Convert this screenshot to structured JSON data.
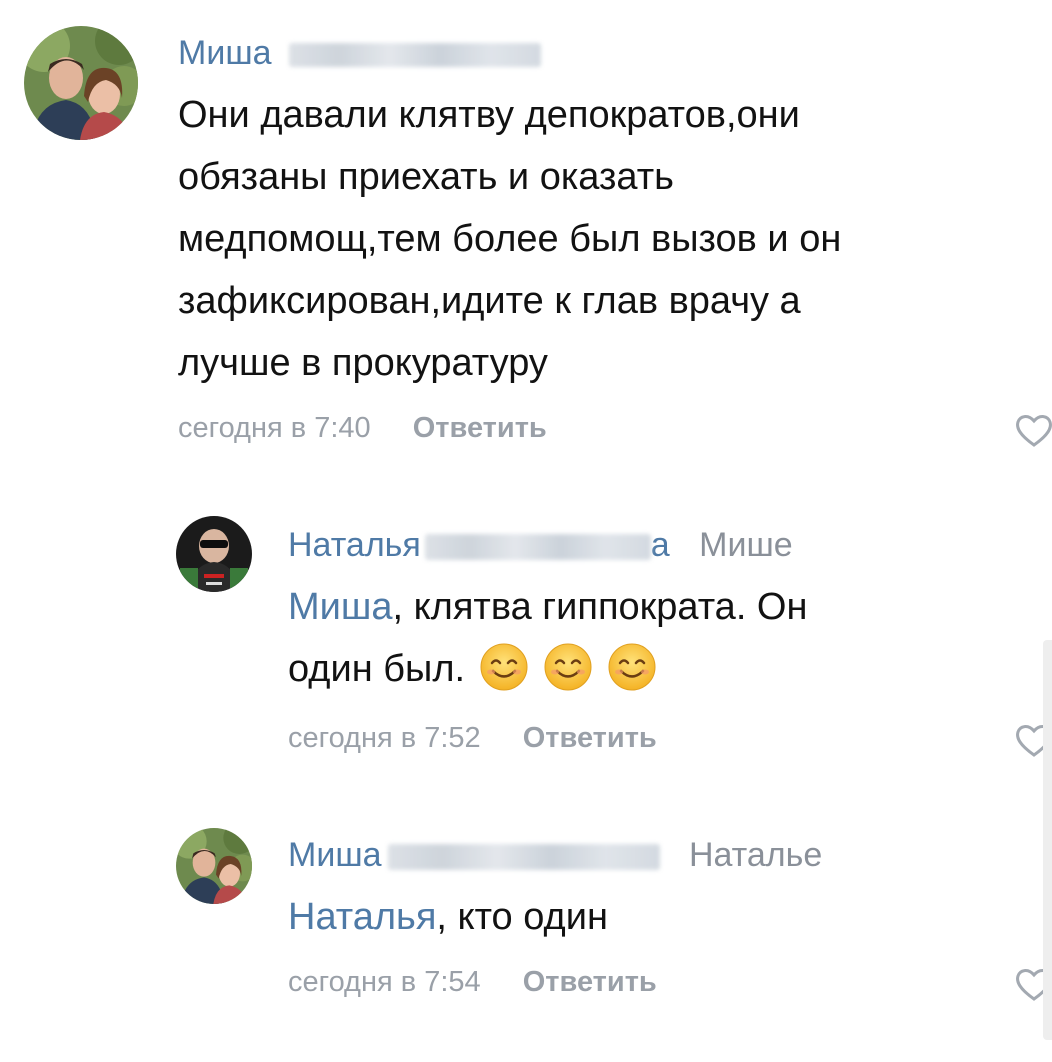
{
  "comments": [
    {
      "author": "Миша",
      "reply_to": "",
      "lines": [
        "Они давали клятву депократов,они",
        "обязаны приехать и оказать",
        "медпомощ,тем более был вызов и он",
        "зафиксирован,идите к глав врачу а",
        "лучше в прокуратуру"
      ],
      "time": "сегодня в 7:40",
      "reply_label": "Ответить"
    },
    {
      "author": "Наталья",
      "author_tail": "а",
      "reply_to": "Мише",
      "mention": "Миша",
      "line1_rest": ", клятва гиппократа. Он",
      "line2": "один был.",
      "emojis": [
        "smiling-face",
        "smiling-face",
        "smiling-face"
      ],
      "time": "сегодня в 7:52",
      "reply_label": "Ответить"
    },
    {
      "author": "Миша",
      "reply_to": "Наталье",
      "mention": "Наталья",
      "line1_rest": ", кто один",
      "time": "сегодня в 7:54",
      "reply_label": "Ответить"
    }
  ],
  "icons": {
    "like": "heart-outline-icon",
    "emoji": "smiling-face-emoji"
  },
  "colors": {
    "link": "#4f7aa6",
    "meta": "#9aa0a8",
    "text": "#121212"
  }
}
